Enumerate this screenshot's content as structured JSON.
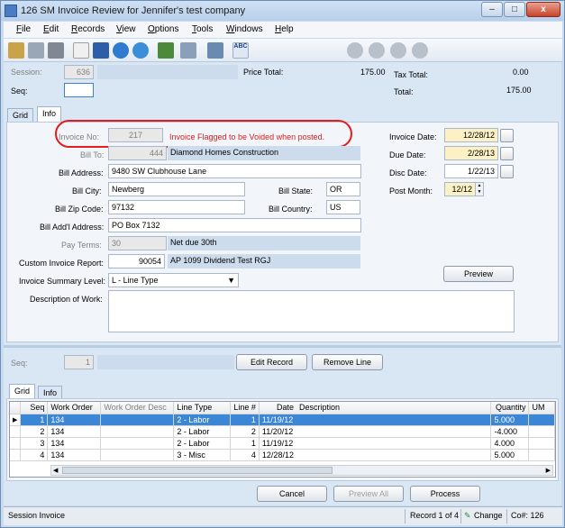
{
  "window": {
    "title": "126 SM Invoice Review for Jennifer's test company",
    "min": "–",
    "max": "□",
    "close": "x"
  },
  "menu": [
    {
      "key": "F",
      "rest": "ile"
    },
    {
      "key": "E",
      "rest": "dit"
    },
    {
      "key": "R",
      "rest": "ecords"
    },
    {
      "key": "V",
      "rest": "iew"
    },
    {
      "key": "O",
      "rest": "ptions"
    },
    {
      "key": "T",
      "rest": "ools"
    },
    {
      "key": "W",
      "rest": "indows"
    },
    {
      "key": "H",
      "rest": "elp"
    }
  ],
  "toolbar_icons": [
    "key-icon",
    "tag-icon",
    "print-icon",
    "new-icon",
    "save-icon",
    "undo-icon",
    "refresh-icon",
    "calculator-icon",
    "attach-icon",
    "send-icon",
    "spellcheck-icon",
    "first-icon",
    "prev-icon",
    "next-icon",
    "last-icon"
  ],
  "header": {
    "session_label": "Session:",
    "session_value": "636",
    "seq_label": "Seq:",
    "price_total_label": "Price Total:",
    "price_total_value": "175.00",
    "tax_total_label": "Tax Total:",
    "tax_total_value": "0.00",
    "total_label": "Total:",
    "total_value": "175.00"
  },
  "tabs_top": [
    "Grid",
    "Info"
  ],
  "info": {
    "invoice_no_label": "Invoice No:",
    "invoice_no_value": "217",
    "flag_text": "Invoice Flagged to be Voided when posted.",
    "bill_to_label": "Bill To:",
    "bill_to_value": "444",
    "bill_to_name": "Diamond Homes Construction",
    "bill_address_label": "Bill Address:",
    "bill_address_value": "9480 SW Clubhouse Lane",
    "bill_city_label": "Bill City:",
    "bill_city_value": "Newberg",
    "bill_state_label": "Bill State:",
    "bill_state_value": "OR",
    "bill_zip_label": "Bill Zip Code:",
    "bill_zip_value": "97132",
    "bill_country_label": "Bill Country:",
    "bill_country_value": "US",
    "bill_add_label": "Bill Add'l Address:",
    "bill_add_value": "PO Box 7132",
    "pay_terms_label": "Pay Terms:",
    "pay_terms_value": "30",
    "pay_terms_desc": "Net due 30th",
    "custom_report_label": "Custom Invoice Report:",
    "custom_report_value": "90054",
    "custom_report_desc": "AP 1099 Dividend Test RGJ",
    "summary_level_label": "Invoice Summary Level:",
    "summary_level_value": "L - Line Type",
    "description_label": "Description of Work:",
    "invoice_date_label": "Invoice Date:",
    "invoice_date_value": "12/28/12",
    "due_date_label": "Due Date:",
    "due_date_value": "2/28/13",
    "disc_date_label": "Disc Date:",
    "disc_date_value": "1/22/13",
    "post_month_label": "Post Month:",
    "post_month_value": "12/12",
    "preview_button": "Preview"
  },
  "lines": {
    "seq_label": "Seq:",
    "seq_value": "1",
    "edit_record": "Edit Record",
    "remove_line": "Remove Line",
    "tabs": [
      "Grid",
      "Info"
    ],
    "columns": [
      "Seq",
      "Work Order",
      "Work Order Desc",
      "Line Type",
      "Line #",
      "Date",
      "Description",
      "Quantity",
      "UM"
    ],
    "rows": [
      [
        "1",
        "134",
        "",
        "2 - Labor",
        "1",
        "11/19/12",
        "",
        "5.000",
        ""
      ],
      [
        "2",
        "134",
        "",
        "2 - Labor",
        "2",
        "11/20/12",
        "",
        "-4.000",
        ""
      ],
      [
        "3",
        "134",
        "",
        "2 - Labor",
        "1",
        "11/19/12",
        "",
        "4.000",
        ""
      ],
      [
        "4",
        "134",
        "",
        "3 - Misc",
        "4",
        "12/28/12",
        "",
        "5.000",
        ""
      ]
    ]
  },
  "footer": {
    "cancel": "Cancel",
    "preview_all": "Preview All",
    "process": "Process"
  },
  "status": {
    "left": "Session Invoice",
    "record": "Record 1 of 4",
    "change": "Change",
    "co": "Co#: 126"
  },
  "colors": {
    "flag_red": "#d81e1e",
    "selected_row": "#3c86d6",
    "yellow_field": "#fbf1c4"
  }
}
